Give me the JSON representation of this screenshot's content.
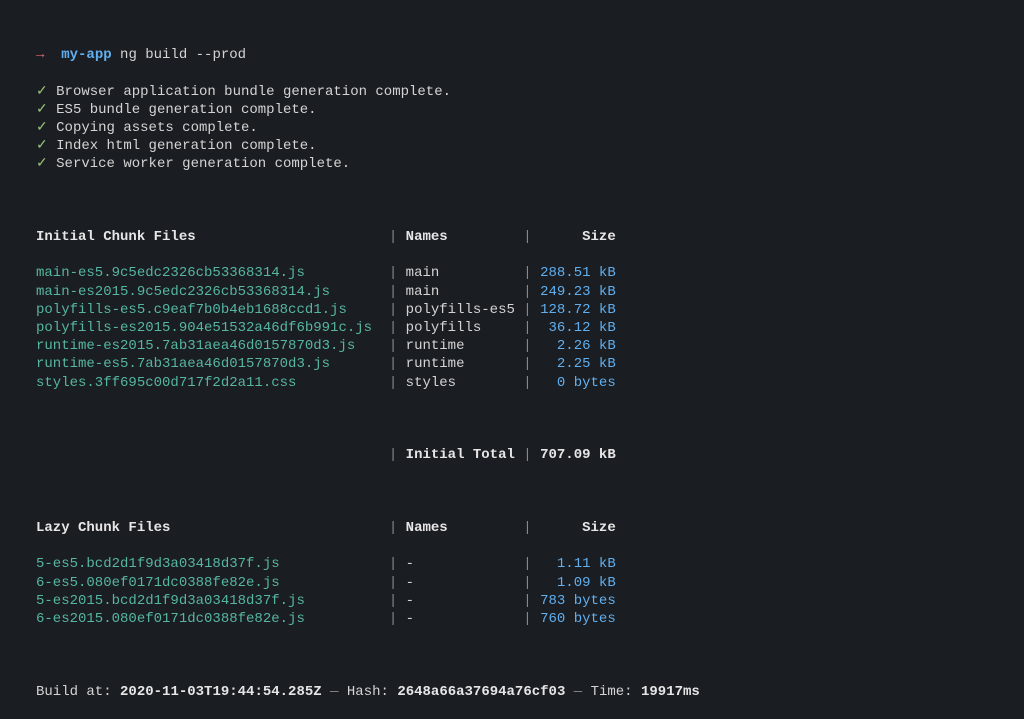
{
  "prompt": {
    "arrow": "→",
    "app": "my-app",
    "command": "ng build --prod"
  },
  "status_lines": [
    "Browser application bundle generation complete.",
    "ES5 bundle generation complete.",
    "Copying assets complete.",
    "Index html generation complete.",
    "Service worker generation complete."
  ],
  "check_glyph": "✓",
  "initial_section": {
    "header_files": "Initial Chunk Files",
    "header_names": "Names",
    "header_size": "Size",
    "rows": [
      {
        "file": "main-es5.9c5edc2326cb53368314.js",
        "name": "main",
        "size": "288.51 kB"
      },
      {
        "file": "main-es2015.9c5edc2326cb53368314.js",
        "name": "main",
        "size": "249.23 kB"
      },
      {
        "file": "polyfills-es5.c9eaf7b0b4eb1688ccd1.js",
        "name": "polyfills-es5",
        "size": "128.72 kB"
      },
      {
        "file": "polyfills-es2015.904e51532a46df6b991c.js",
        "name": "polyfills",
        "size": "36.12 kB"
      },
      {
        "file": "runtime-es2015.7ab31aea46d0157870d3.js",
        "name": "runtime",
        "size": "2.26 kB"
      },
      {
        "file": "runtime-es5.7ab31aea46d0157870d3.js",
        "name": "runtime",
        "size": "2.25 kB"
      },
      {
        "file": "styles.3ff695c00d717f2d2a11.css",
        "name": "styles",
        "size": "0 bytes"
      }
    ],
    "total_label": "Initial Total",
    "total_size": "707.09 kB"
  },
  "lazy_section": {
    "header_files": "Lazy Chunk Files",
    "header_names": "Names",
    "header_size": "Size",
    "rows": [
      {
        "file": "5-es5.bcd2d1f9d3a03418d37f.js",
        "name": "-",
        "size": "1.11 kB"
      },
      {
        "file": "6-es5.080ef0171dc0388fe82e.js",
        "name": "-",
        "size": "1.09 kB"
      },
      {
        "file": "5-es2015.bcd2d1f9d3a03418d37f.js",
        "name": "-",
        "size": "783 bytes"
      },
      {
        "file": "6-es2015.080ef0171dc0388fe82e.js",
        "name": "-",
        "size": "760 bytes"
      }
    ]
  },
  "build_footer": {
    "build_at_label": "Build at:",
    "build_at_value": "2020-11-03T19:44:54.285Z",
    "hash_label": "Hash:",
    "hash_value": "2648a66a37694a76cf03",
    "time_label": "Time:",
    "time_value": "19917ms"
  },
  "columns": {
    "file_width": 42,
    "name_width": 14,
    "size_width": 10
  }
}
